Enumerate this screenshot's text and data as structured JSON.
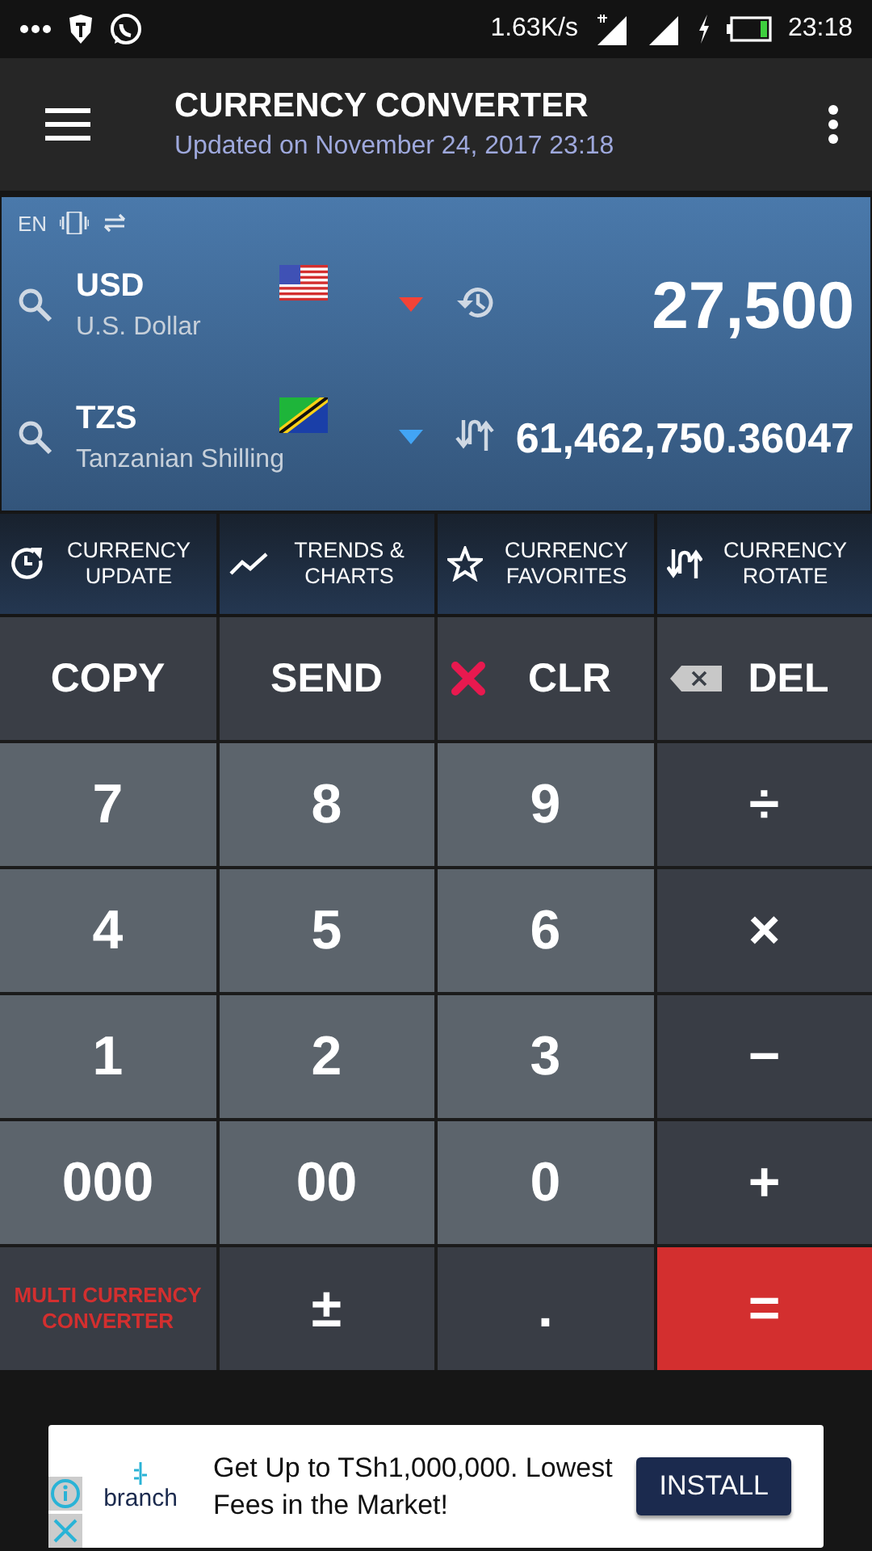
{
  "status_bar": {
    "speed": "1.63K/s",
    "time": "23:18"
  },
  "app_bar": {
    "title": "CURRENCY CONVERTER",
    "subtitle": "Updated on November 24, 2017 23:18"
  },
  "converter": {
    "language": "EN",
    "currencies": [
      {
        "code": "USD",
        "name": "U.S. Dollar",
        "amount": "27,500"
      },
      {
        "code": "TZS",
        "name": "Tanzanian Shilling",
        "amount": "61,462,750.36047"
      }
    ]
  },
  "actions": [
    {
      "label": "CURRENCY UPDATE"
    },
    {
      "label": "TRENDS & CHARTS"
    },
    {
      "label": "CURRENCY FAVORITES"
    },
    {
      "label": "CURRENCY ROTATE"
    }
  ],
  "keys": [
    {
      "kind": "function",
      "label": "COPY"
    },
    {
      "kind": "function",
      "label": "SEND"
    },
    {
      "kind": "function",
      "label": "CLR"
    },
    {
      "kind": "function",
      "label": "DEL"
    },
    {
      "kind": "digit",
      "label": "7"
    },
    {
      "kind": "digit",
      "label": "8"
    },
    {
      "kind": "digit",
      "label": "9"
    },
    {
      "kind": "operator",
      "label": "÷"
    },
    {
      "kind": "digit",
      "label": "4"
    },
    {
      "kind": "digit",
      "label": "5"
    },
    {
      "kind": "digit",
      "label": "6"
    },
    {
      "kind": "operator",
      "label": "×"
    },
    {
      "kind": "digit",
      "label": "1"
    },
    {
      "kind": "digit",
      "label": "2"
    },
    {
      "kind": "digit",
      "label": "3"
    },
    {
      "kind": "operator",
      "label": "−"
    },
    {
      "kind": "digit",
      "label": "000"
    },
    {
      "kind": "digit",
      "label": "00"
    },
    {
      "kind": "digit",
      "label": "0"
    },
    {
      "kind": "operator",
      "label": "+"
    },
    {
      "kind": "special",
      "label": "MULTI CURRENCY CONVERTER"
    },
    {
      "kind": "operator",
      "label": "±"
    },
    {
      "kind": "operator",
      "label": "."
    },
    {
      "kind": "equals",
      "label": "="
    }
  ],
  "ad": {
    "logo": "branch",
    "text": "Get Up to TSh1,000,000. Lowest Fees in the Market!",
    "button": "INSTALL"
  }
}
